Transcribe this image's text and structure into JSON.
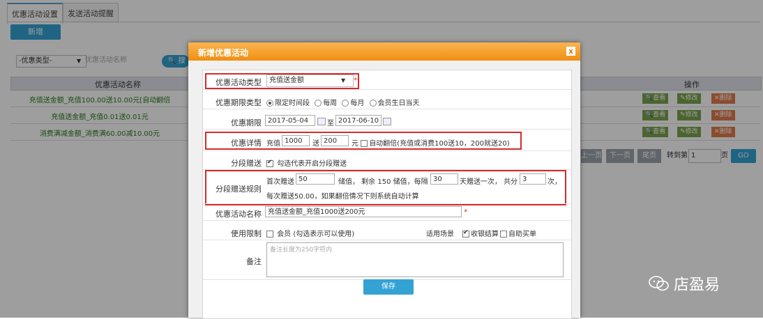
{
  "tabs": [
    "优惠活动设置",
    "发送活动提醒"
  ],
  "new_button": "新增",
  "filter": {
    "type_select": "-优惠类型-",
    "name_placeholder": "优惠活动名称",
    "search_button": "搜"
  },
  "grid": {
    "headers": {
      "name": "优惠活动名称",
      "actions": "操作"
    },
    "rows": [
      {
        "name": "充值送金额_充值100.00送10.00元[自动翻倍"
      },
      {
        "name": "充值送金额_充值0.01送0.01元"
      },
      {
        "name": "消费满减金额_消费满60.00减10.00元"
      }
    ],
    "actions": {
      "view": "查看",
      "edit": "修改",
      "delete": "删除"
    }
  },
  "pager": {
    "prev": "上一页",
    "next": "下一页",
    "last": "尾页",
    "goto": "转到第",
    "page_value": "1",
    "page_unit": "页",
    "go": "GO"
  },
  "modal": {
    "title": "新增优惠活动",
    "close": "x",
    "fields": {
      "type_label": "优惠活动类型",
      "type_value": "充值送金额",
      "period_type_label": "优惠期限类型",
      "period_types": [
        "限定时间段",
        "每周",
        "每月",
        "会员生日当天"
      ],
      "period_label": "优惠期限",
      "start_date": "2017-05-04",
      "to": "至",
      "end_date": "2017-06-10",
      "detail_label": "优惠详情",
      "recharge": "充值",
      "recharge_value": "1000",
      "give": "送",
      "give_value": "200",
      "yuan": "元",
      "auto_double": "自动翻倍(充值或消费100送10，200就送20)",
      "stage_label": "分段赠送",
      "stage_check": "勾选代表开启分段赠送",
      "stage_rule_label": "分段赠送规则",
      "first_give": "首次赠送",
      "first_value": "50",
      "stored_value": "储值， 剩余 150 储值，每隔",
      "interval_value": "30",
      "days_once": "天赠送一次， 共分",
      "parts_value": "3",
      "times": "次，",
      "rule_note": "每次赠送50.00，如果翻倍情况下则系统自动计算",
      "name_label": "优惠活动名称",
      "name_value": "充值送金额_充值1000送200元",
      "limit_label": "使用限制",
      "member": "会员",
      "member_note": "(勾选表示可以使用)",
      "scene_label": "适用场景",
      "scene_checkout": "收银结算",
      "scene_self": "自助买单",
      "remark_label": "备注",
      "remark_placeholder": "备注长度为250字符内"
    },
    "save": "保存"
  },
  "watermark": "店盈易"
}
